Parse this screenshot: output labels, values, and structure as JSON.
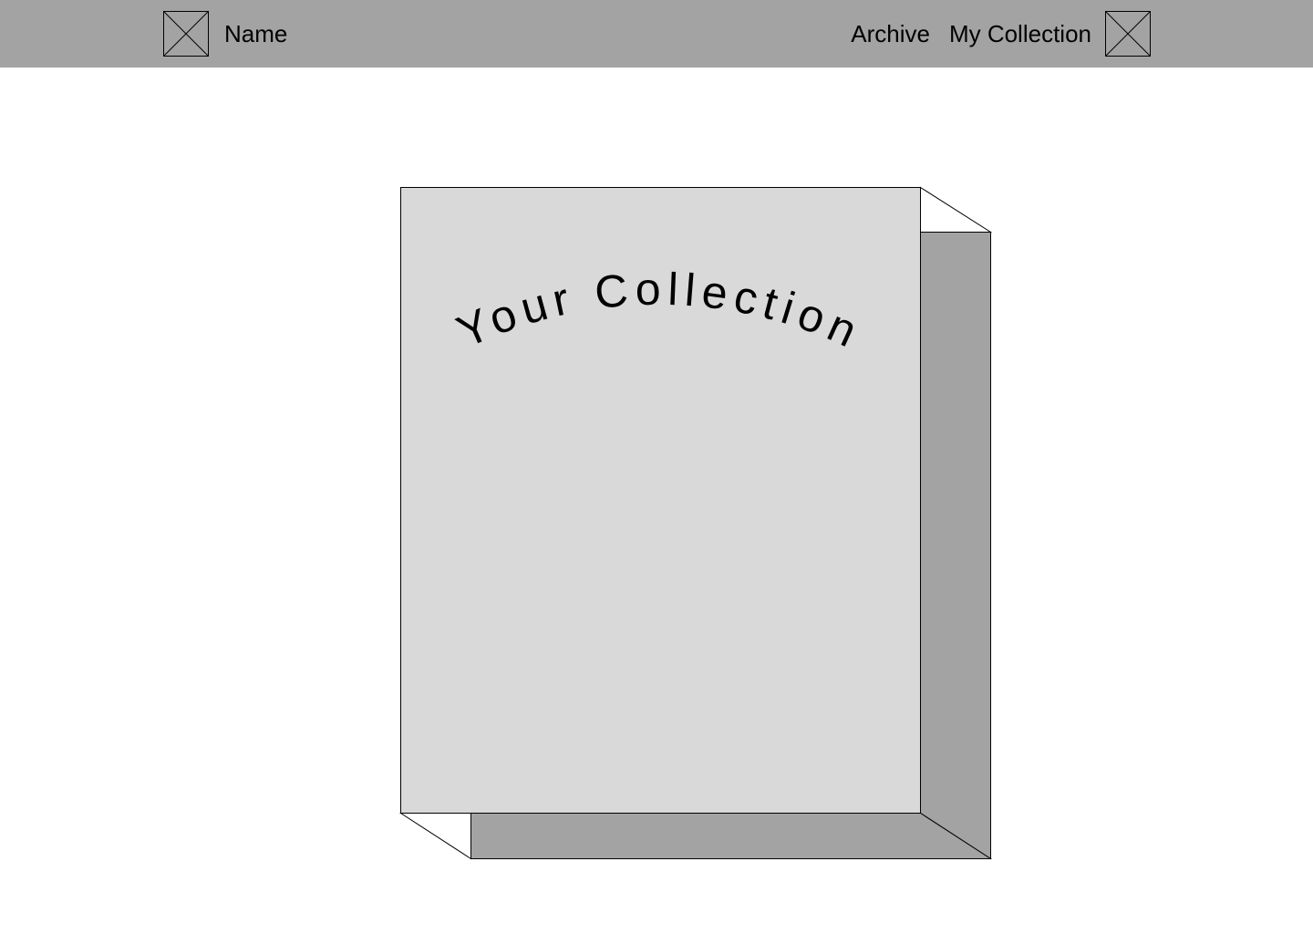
{
  "header": {
    "brand_name": "Name",
    "logo_icon": "image-placeholder-icon",
    "profile_icon": "image-placeholder-icon",
    "nav": [
      {
        "label": "Archive"
      },
      {
        "label": "My Collection"
      }
    ]
  },
  "main": {
    "book_title": "Your Collection"
  },
  "colors": {
    "header_bg": "#a3a3a3",
    "book_cover": "#d9d9d9",
    "book_side": "#a3a3a3",
    "page_bg": "#ffffff"
  }
}
